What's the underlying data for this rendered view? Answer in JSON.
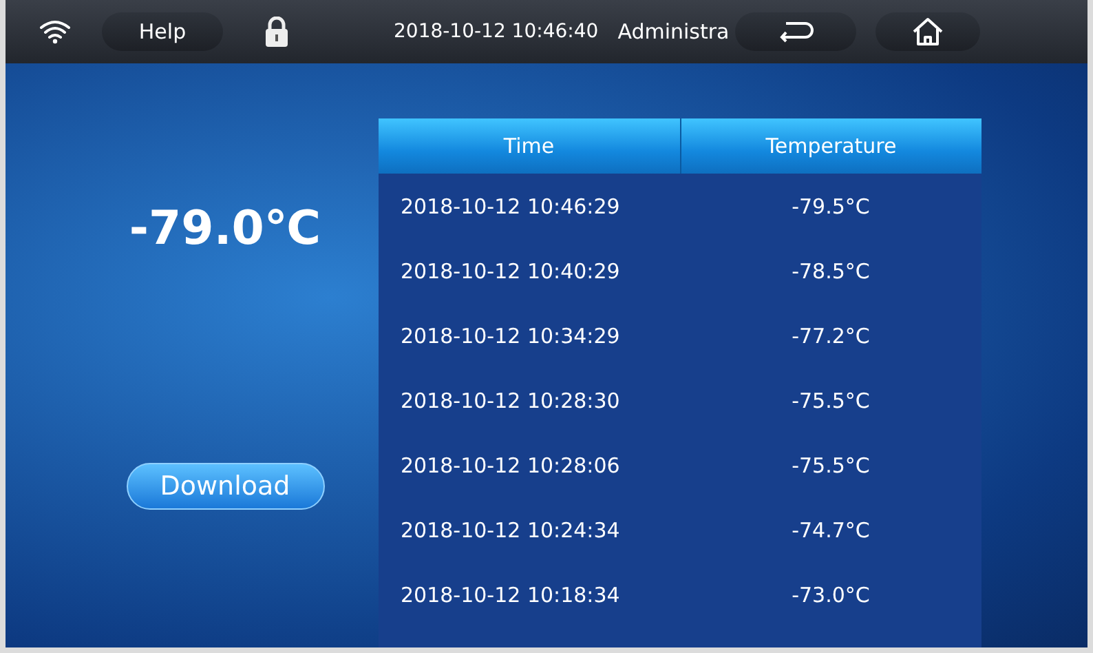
{
  "top_bar": {
    "help": "Help",
    "datetime": "2018-10-12 10:46:40",
    "user": "Administra"
  },
  "reading": "-79.0℃",
  "download_button": "Download",
  "table": {
    "columns": [
      "Time",
      "Temperature"
    ],
    "rows": [
      [
        "2018-10-12 10:46:29",
        "-79.5°C"
      ],
      [
        "2018-10-12 10:40:29",
        "-78.5°C"
      ],
      [
        "2018-10-12 10:34:29",
        "-77.2°C"
      ],
      [
        "2018-10-12 10:28:30",
        "-75.5°C"
      ],
      [
        "2018-10-12 10:28:06",
        "-75.5°C"
      ],
      [
        "2018-10-12 10:24:34",
        "-74.7°C"
      ],
      [
        "2018-10-12 10:18:34",
        "-73.0°C"
      ]
    ]
  }
}
